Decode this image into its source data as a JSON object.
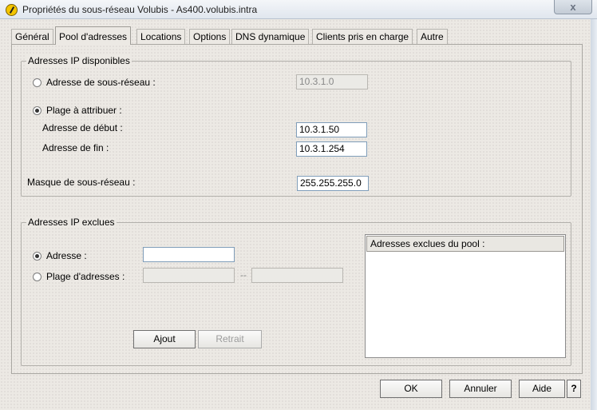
{
  "window": {
    "title": "Propriétés du sous-réseau Volubis - As400.volubis.intra",
    "close_label": "x"
  },
  "tabs": [
    {
      "label": "Général",
      "active": false
    },
    {
      "label": "Pool d'adresses",
      "active": true
    },
    {
      "label": "Locations",
      "active": false
    },
    {
      "label": "Options",
      "active": false
    },
    {
      "label": "DNS dynamique",
      "active": false
    },
    {
      "label": "Clients pris en charge",
      "active": false
    },
    {
      "label": "Autre",
      "active": false
    }
  ],
  "available": {
    "group_title": "Adresses IP disponibles",
    "subnet_address_label": "Adresse de sous-réseau :",
    "subnet_address_value": "10.3.1.0",
    "range_label": "Plage à attribuer :",
    "start_label": "Adresse de début :",
    "start_value": "10.3.1.50",
    "end_label": "Adresse de fin :",
    "end_value": "10.3.1.254",
    "selected": "range"
  },
  "mask": {
    "label": "Masque de sous-réseau :",
    "value": "255.255.255.0"
  },
  "excluded": {
    "group_title": "Adresses IP exclues",
    "address_label": "Adresse :",
    "address_value": "",
    "range_label": "Plage d'adresses :",
    "range_start_value": "",
    "range_end_value": "",
    "range_separator": "--",
    "selected": "address",
    "add_label": "Ajout",
    "remove_label": "Retrait",
    "list_header": "Adresses exclues du pool :",
    "list_items": []
  },
  "footer": {
    "ok_label": "OK",
    "cancel_label": "Annuler",
    "help_label": "Aide",
    "whats_this_label": "?"
  }
}
